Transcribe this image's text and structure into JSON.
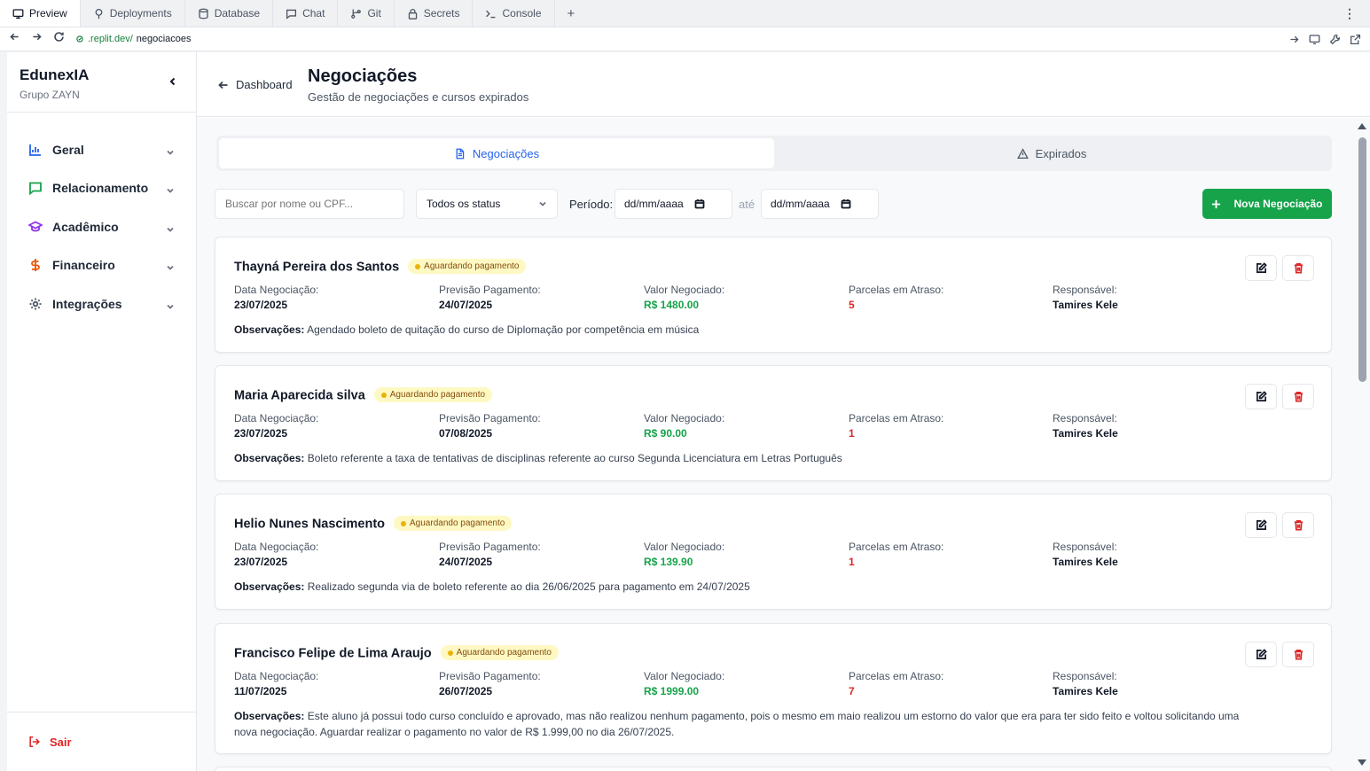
{
  "ide": {
    "tabs": [
      {
        "label": "Preview",
        "icon": "monitor-icon"
      },
      {
        "label": "Deployments",
        "icon": "deploy-icon"
      },
      {
        "label": "Database",
        "icon": "database-icon"
      },
      {
        "label": "Chat",
        "icon": "chat-icon"
      },
      {
        "label": "Git",
        "icon": "git-icon"
      },
      {
        "label": "Secrets",
        "icon": "lock-icon"
      },
      {
        "label": "Console",
        "icon": "terminal-icon"
      }
    ],
    "plus": "+",
    "more": "⋮"
  },
  "url": {
    "host": ".replit.dev/",
    "path": "negociacoes"
  },
  "sidebar": {
    "brand": "EdunexIA",
    "sub": "Grupo ZAYN",
    "items": [
      {
        "label": "Geral",
        "icon": "bar-chart-icon",
        "color": "#2563eb"
      },
      {
        "label": "Relacionamento",
        "icon": "message-square-icon",
        "color": "#16a34a"
      },
      {
        "label": "Acadêmico",
        "icon": "graduation-cap-icon",
        "color": "#9333ea"
      },
      {
        "label": "Financeiro",
        "icon": "dollar-icon",
        "color": "#ea580c"
      },
      {
        "label": "Integrações",
        "icon": "gear-icon",
        "color": "#4b5563"
      }
    ],
    "logout": "Sair"
  },
  "header": {
    "back": "Dashboard",
    "title": "Negociações",
    "subtitle": "Gestão de negociações e cursos expirados"
  },
  "tabs": [
    {
      "label": "Negociações",
      "active": true
    },
    {
      "label": "Expirados",
      "active": false
    }
  ],
  "filters": {
    "search_placeholder": "Buscar por nome ou CPF...",
    "status": "Todos os status",
    "periodo": "Período:",
    "date_from": "dd/mm/aaaa",
    "ate": "até",
    "date_to": "dd/mm/aaaa",
    "new_button": "Nova Negociação"
  },
  "labels": {
    "data": "Data Negociação:",
    "previsao": "Previsão Pagamento:",
    "valor": "Valor Negociado:",
    "parcelas": "Parcelas em Atraso:",
    "responsavel": "Responsável:",
    "obs": "Observações:"
  },
  "colors": {
    "accent_green": "#16a34a",
    "danger_red": "#dc2626",
    "badge_bg": "#fef9c3"
  },
  "cards": [
    {
      "name": "Thayná Pereira dos Santos",
      "status": "Aguardando pagamento",
      "data": "23/07/2025",
      "previsao": "24/07/2025",
      "valor": "R$ 1480.00",
      "parcelas": "5",
      "responsavel": "Tamires Kele",
      "obs": "Agendado boleto de quitação do curso de Diplomação por competência em música"
    },
    {
      "name": "Maria Aparecida silva",
      "status": "Aguardando pagamento",
      "data": "23/07/2025",
      "previsao": "07/08/2025",
      "valor": "R$ 90.00",
      "parcelas": "1",
      "responsavel": "Tamires Kele",
      "obs": "Boleto referente a taxa de tentativas de disciplinas referente ao curso Segunda Licenciatura em Letras Português"
    },
    {
      "name": "Helio Nunes Nascimento",
      "status": "Aguardando pagamento",
      "data": "23/07/2025",
      "previsao": "24/07/2025",
      "valor": "R$ 139.90",
      "parcelas": "1",
      "responsavel": "Tamires Kele",
      "obs": "Realizado segunda via de boleto referente ao dia 26/06/2025 para pagamento em 24/07/2025"
    },
    {
      "name": "Francisco Felipe de Lima Araujo",
      "status": "Aguardando pagamento",
      "data": "11/07/2025",
      "previsao": "26/07/2025",
      "valor": "R$ 1999.00",
      "parcelas": "7",
      "responsavel": "Tamires Kele",
      "obs": "Este aluno já possui todo curso concluído e aprovado, mas não realizou nenhum pagamento, pois o mesmo em maio realizou um estorno do valor que era para ter sido feito e voltou solicitando uma nova negociação. Aguardar realizar o pagamento no valor de R$ 1.999,00 no dia 26/07/2025."
    }
  ]
}
